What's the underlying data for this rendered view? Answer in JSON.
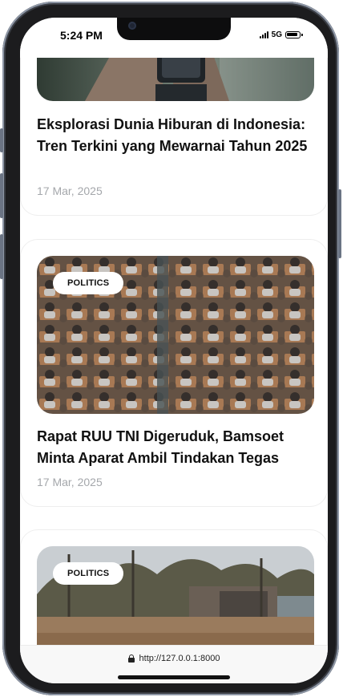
{
  "status": {
    "time": "5:24 PM",
    "network": "5G"
  },
  "articles": [
    {
      "title": "Eksplorasi Dunia Hiburan di Indonesia: Tren Terkini yang Mewarnai Tahun 2025",
      "date": "17 Mar, 2025",
      "image_icon": "photo-hands-phone"
    },
    {
      "category": "POLITICS",
      "title": "Rapat RUU TNI Digeruduk, Bamsoet Minta Aparat Ambil Tindakan Tegas",
      "date": "17 Mar, 2025",
      "image_icon": "photo-parliament-audience"
    },
    {
      "category": "POLITICS",
      "image_icon": "photo-flooded-street"
    }
  ],
  "browser": {
    "url": "http://127.0.0.1:8000"
  },
  "colors": {
    "text": "#111111",
    "muted": "#a4a7ab",
    "frame": "#1c1c1e"
  }
}
